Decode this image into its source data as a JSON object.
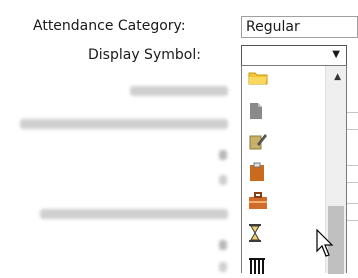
{
  "form": {
    "attendance_category_label": "Attendance Category:",
    "attendance_category_value": "Regular",
    "display_symbol_label": "Display Symbol:",
    "display_symbol_value": "",
    "display_symbol_arrow": "▼"
  },
  "dropdown": {
    "options": [
      {
        "icon": "folder-icon",
        "color": "#f4c433"
      },
      {
        "icon": "document-icon",
        "color": "#8a8a8a"
      },
      {
        "icon": "notepad-pencil-icon",
        "color": "#c9b16a"
      },
      {
        "icon": "clipboard-icon",
        "color": "#c96a1c"
      },
      {
        "icon": "briefcase-icon",
        "color": "#d06b2a"
      },
      {
        "icon": "hourglass-icon",
        "color": "#3b3b3b"
      },
      {
        "icon": "barcode-icon",
        "color": "#111111"
      }
    ],
    "scroll_up": "▲"
  },
  "colors": {
    "border": "#8e8e8e",
    "scrollbar_thumb": "#c0c0c0"
  }
}
